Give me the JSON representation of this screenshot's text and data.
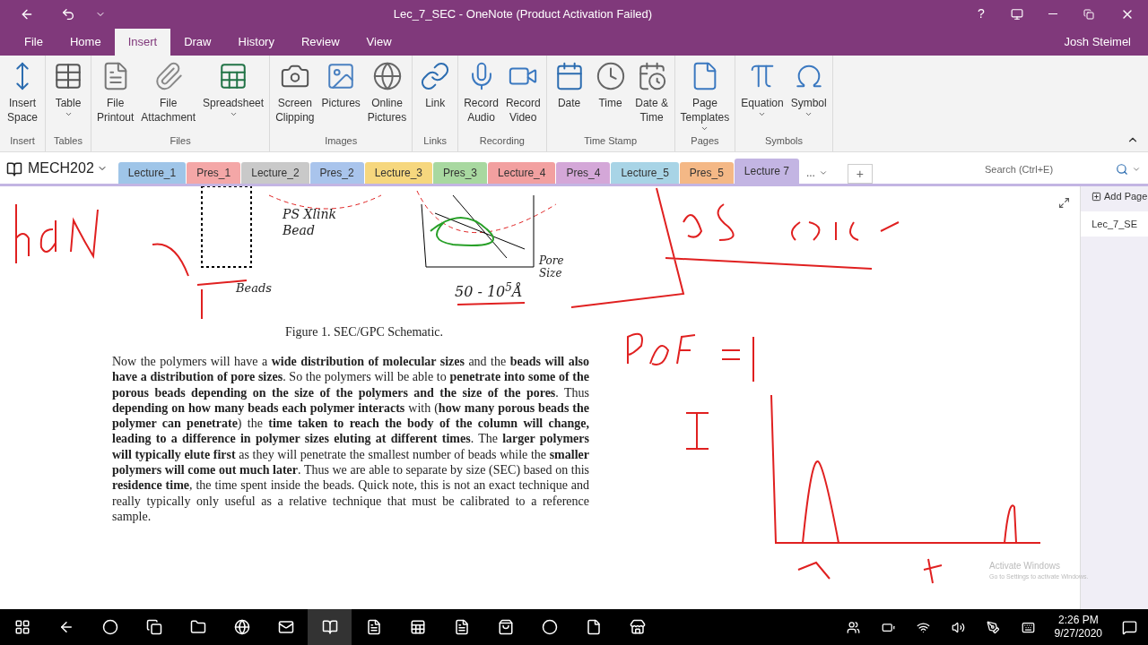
{
  "title_bar": {
    "title": "Lec_7_SEC - OneNote (Product Activation Failed)",
    "help": "?"
  },
  "menu_tabs": [
    {
      "label": "File",
      "selected": false
    },
    {
      "label": "Home",
      "selected": false
    },
    {
      "label": "Insert",
      "selected": true
    },
    {
      "label": "Draw",
      "selected": false
    },
    {
      "label": "History",
      "selected": false
    },
    {
      "label": "Review",
      "selected": false
    },
    {
      "label": "View",
      "selected": false
    }
  ],
  "user": "Josh Steimel",
  "ribbon": [
    {
      "name": "Insert",
      "buttons": [
        {
          "label": "Insert\nSpace",
          "dropdown": false
        }
      ]
    },
    {
      "name": "Tables",
      "buttons": [
        {
          "label": "Table",
          "dropdown": true
        }
      ]
    },
    {
      "name": "Files",
      "buttons": [
        {
          "label": "File\nPrintout",
          "dropdown": false
        },
        {
          "label": "File\nAttachment",
          "dropdown": false
        },
        {
          "label": "Spreadsheet",
          "dropdown": true
        }
      ]
    },
    {
      "name": "Images",
      "buttons": [
        {
          "label": "Screen\nClipping",
          "dropdown": false
        },
        {
          "label": "Pictures",
          "dropdown": false
        },
        {
          "label": "Online\nPictures",
          "dropdown": false
        }
      ]
    },
    {
      "name": "Links",
      "buttons": [
        {
          "label": "Link",
          "dropdown": false
        }
      ]
    },
    {
      "name": "Recording",
      "buttons": [
        {
          "label": "Record\nAudio",
          "dropdown": false
        },
        {
          "label": "Record\nVideo",
          "dropdown": false
        }
      ]
    },
    {
      "name": "Time Stamp",
      "buttons": [
        {
          "label": "Date",
          "dropdown": false
        },
        {
          "label": "Time",
          "dropdown": false
        },
        {
          "label": "Date &\nTime",
          "dropdown": false
        }
      ]
    },
    {
      "name": "Pages",
      "buttons": [
        {
          "label": "Page\nTemplates",
          "dropdown": true
        }
      ]
    },
    {
      "name": "Symbols",
      "buttons": [
        {
          "label": "Equation",
          "dropdown": true
        },
        {
          "label": "Symbol",
          "dropdown": true
        }
      ]
    }
  ],
  "notebook": "MECH202",
  "sections": [
    {
      "label": "Lecture_1",
      "color": "#9fc5e8",
      "selected": false
    },
    {
      "label": "Pres_1",
      "color": "#f4a7a7",
      "selected": false
    },
    {
      "label": "Lecture_2",
      "color": "#c9c9c9",
      "selected": false
    },
    {
      "label": "Pres_2",
      "color": "#a9c4ec",
      "selected": false
    },
    {
      "label": "Lecture_3",
      "color": "#f6d77e",
      "selected": false
    },
    {
      "label": "Pres_3",
      "color": "#a8d8a0",
      "selected": false
    },
    {
      "label": "Lecture_4",
      "color": "#f2a0a0",
      "selected": false
    },
    {
      "label": "Pres_4",
      "color": "#d4a7d8",
      "selected": false
    },
    {
      "label": "Lecture_5",
      "color": "#a8d4e6",
      "selected": false
    },
    {
      "label": "Pres_5",
      "color": "#f4b886",
      "selected": false
    },
    {
      "label": "Lecture 7",
      "color": "#c3b5e3",
      "selected": true
    }
  ],
  "more_sections": "...",
  "add_section": "+",
  "search": {
    "placeholder": "Search (Ctrl+E)"
  },
  "pages_panel": {
    "add_page": "Add Page",
    "pages": [
      {
        "label": "Lec_7_SE",
        "selected": true
      }
    ]
  },
  "figure_labels": [
    "PS Xlink Bead",
    "Pore Size",
    "Beads",
    "50 - 10$^{5}$Å"
  ],
  "caption": "Figure 1. SEC/GPC Schematic.",
  "paragraph": "Now the polymers will have a **wide distribution of molecular sizes** and the **beads will also have a distribution of pore sizes**. So the polymers will be able to **penetrate into some of the porous beads depending on the size of the polymers and the size of the pores**. Thus **depending on how many beads each polymer interacts** with (**how many porous beads the polymer can penetrate**) the **time taken to reach the body of the column will change, leading to a difference in polymer sizes eluting at different times**. The **larger polymers will typically elute first** as they will penetrate the smallest number of beads while the **smaller polymers will come out much later**. Thus we are able to separate by size (SEC) based on this **residence time**, the time spent inside the beads. Quick note, this is not an exact technique and really typically only useful as a relative technique that must be calibrated to a reference sample.",
  "activation": {
    "title": "Activate Windows",
    "hint": "Go to Settings to activate Windows."
  },
  "taskbar": {
    "time": "2:26 PM",
    "date": "9/27/2020"
  }
}
